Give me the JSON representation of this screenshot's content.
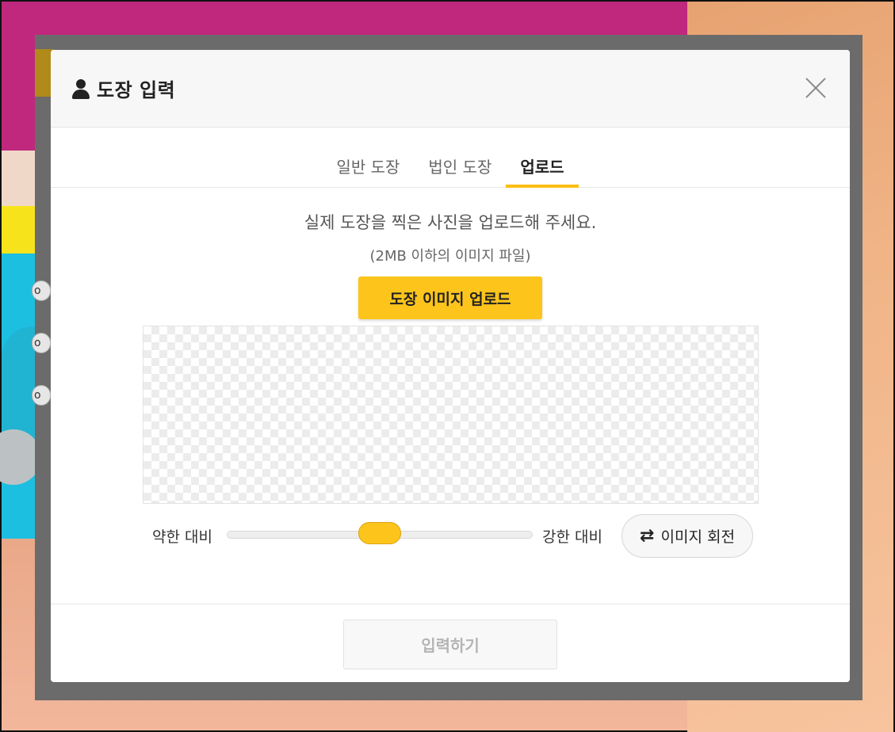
{
  "modal": {
    "title": "도장 입력",
    "icon": "person-icon"
  },
  "tabs": [
    {
      "label": "일반 도장",
      "active": false
    },
    {
      "label": "법인 도장",
      "active": false
    },
    {
      "label": "업로드",
      "active": true
    }
  ],
  "upload": {
    "description": "실제 도장을 찍은 사진을 업로드해 주세요.",
    "limit_note": "(2MB 이하의 이미지 파일)",
    "button_label": "도장 이미지 업로드"
  },
  "contrast": {
    "weak_label": "약한 대비",
    "strong_label": "강한 대비",
    "level": 0.5
  },
  "rotate": {
    "label": "이미지 회전",
    "icon": "rotate-icon"
  },
  "footer": {
    "submit_label": "입력하기"
  },
  "background": {
    "behind_pill_text": "o"
  },
  "colors": {
    "accent": "#fdc41c"
  }
}
